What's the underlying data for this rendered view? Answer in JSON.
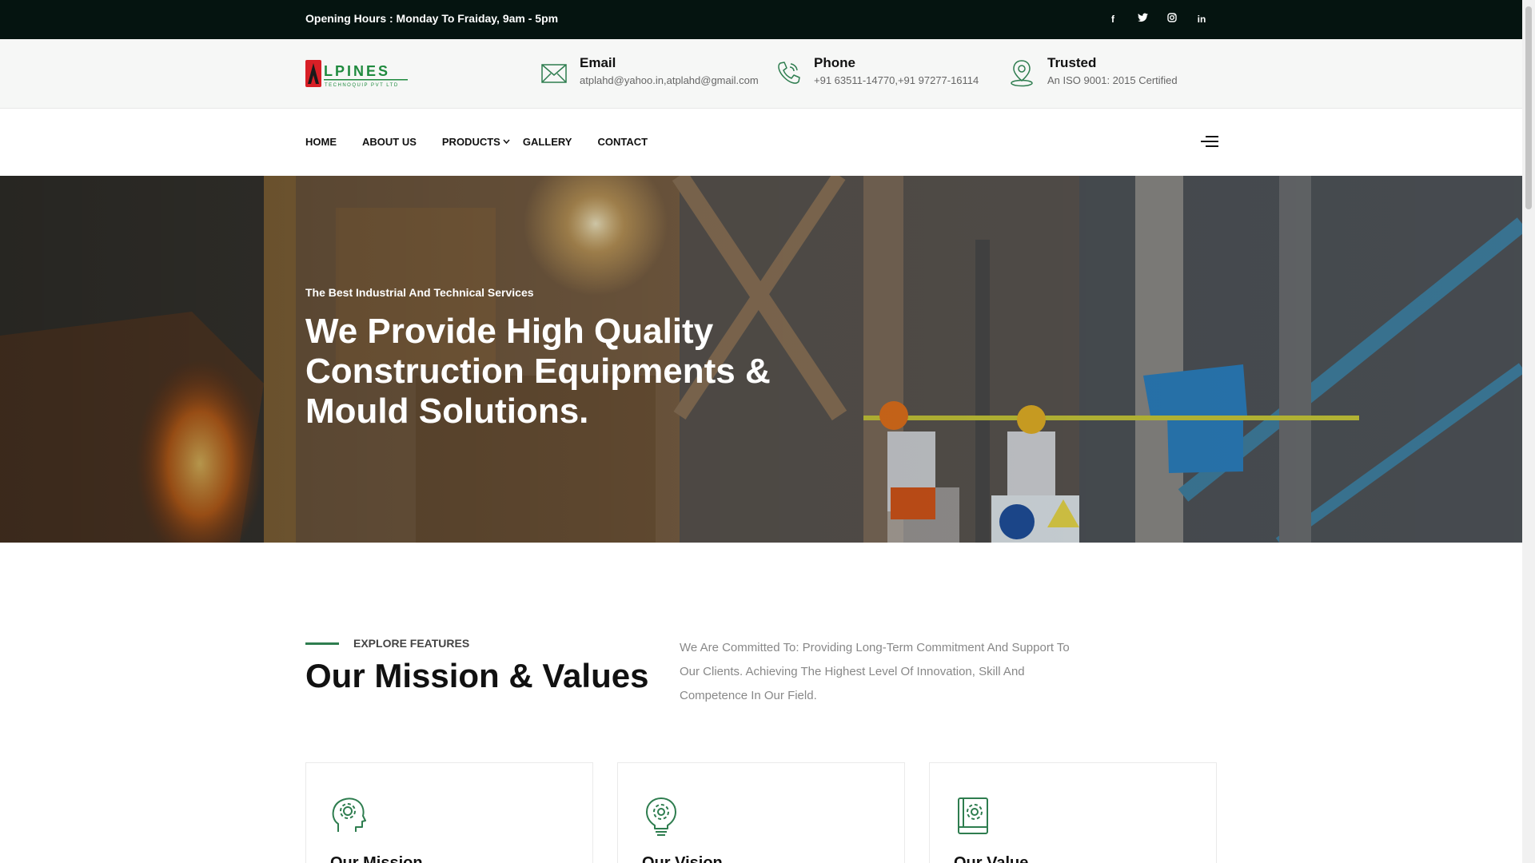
{
  "topbar": {
    "hours": "Opening Hours : Monday To Fraiday, 9am - 5pm",
    "social": [
      {
        "icon": "facebook-icon",
        "glyph": "f"
      },
      {
        "icon": "twitter-icon"
      },
      {
        "icon": "instagram-icon"
      },
      {
        "icon": "linkedin-icon",
        "glyph": "in"
      }
    ]
  },
  "logo": {
    "text": "ALPINES",
    "sub": "TECHNOQUIP PVT LTD",
    "accent": "#d81f26",
    "brand": "#1f8a3e"
  },
  "info": {
    "email": {
      "label": "Email",
      "value": "atplahd@yahoo.in,atplahd@gmail.com"
    },
    "phone": {
      "label": "Phone",
      "value": "+91 63511-14770,+91 97277-16114"
    },
    "trusted": {
      "label": "Trusted",
      "value": "An ISO 9001: 2015 Certified"
    }
  },
  "nav": {
    "items": [
      "HOME",
      "ABOUT US",
      "PRODUCTS",
      "GALLERY",
      "CONTACT"
    ]
  },
  "hero": {
    "subtitle": "The Best Industrial And Technical Services",
    "title": "We Provide High Quality Construction Equipments & Mould Solutions."
  },
  "features": {
    "label": "EXPLORE FEATURES",
    "title": "Our Mission & Values",
    "text": "We Are Committed To: Providing Long-Term Commitment And Support To Our Clients. Achieving The Highest Level Of Innovation, Skill And Competence In Our Field.",
    "cards": [
      {
        "title": "Our Mission",
        "icon": "head-gear-icon"
      },
      {
        "title": "Our Vision",
        "icon": "lightbulb-gear-icon"
      },
      {
        "title": "Our Value",
        "icon": "book-gear-icon"
      }
    ]
  },
  "colors": {
    "topbar": "#051410",
    "accent": "#2e7d4f"
  }
}
